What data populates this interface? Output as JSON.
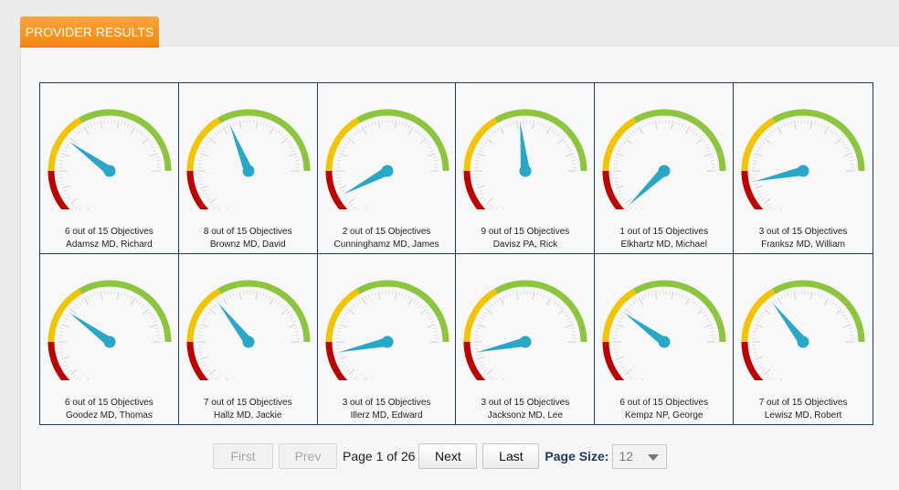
{
  "section_title": "PROVIDER RESULTS",
  "colors": {
    "red": "#c00000",
    "yellow": "#f5c400",
    "green": "#8cc63f",
    "needle": "#28a7c7",
    "tab": "#f7941d",
    "grid_border": "#1f3864"
  },
  "providers": [
    {
      "objectives": "6 out of 15 Objectives",
      "name": "Adamsz MD, Richard",
      "value": 6
    },
    {
      "objectives": "8 out of 15 Objectives",
      "name": "Brownz MD, David",
      "value": 8
    },
    {
      "objectives": "2 out of 15 Objectives",
      "name": "Cunninghamz MD, James",
      "value": 2
    },
    {
      "objectives": "9 out of 15 Objectives",
      "name": "Davisz PA, Rick",
      "value": 9
    },
    {
      "objectives": "1 out of 15 Objectives",
      "name": "Elkhartz MD, Michael",
      "value": 1
    },
    {
      "objectives": "3 out of 15 Objectives",
      "name": "Franksz MD, William",
      "value": 3
    },
    {
      "objectives": "6 out of 15 Objectives",
      "name": "Goodez MD, Thomas",
      "value": 6
    },
    {
      "objectives": "7 out of 15 Objectives",
      "name": "Hallz MD, Jackie",
      "value": 7
    },
    {
      "objectives": "3 out of 15 Objectives",
      "name": "Illerz MD, Edward",
      "value": 3
    },
    {
      "objectives": "3 out of 15 Objectives",
      "name": "Jacksonz MD, Lee",
      "value": 3
    },
    {
      "objectives": "6 out of 15 Objectives",
      "name": "Kempz NP, George",
      "value": 6
    },
    {
      "objectives": "7 out of 15 Objectives",
      "name": "Lewisz MD, Robert",
      "value": 7
    }
  ],
  "gauge_max": 15,
  "pager": {
    "first": "First",
    "prev": "Prev",
    "page_info": "Page 1 of 26",
    "next": "Next",
    "last": "Last",
    "page_size_label": "Page Size:",
    "page_size_value": "12"
  }
}
